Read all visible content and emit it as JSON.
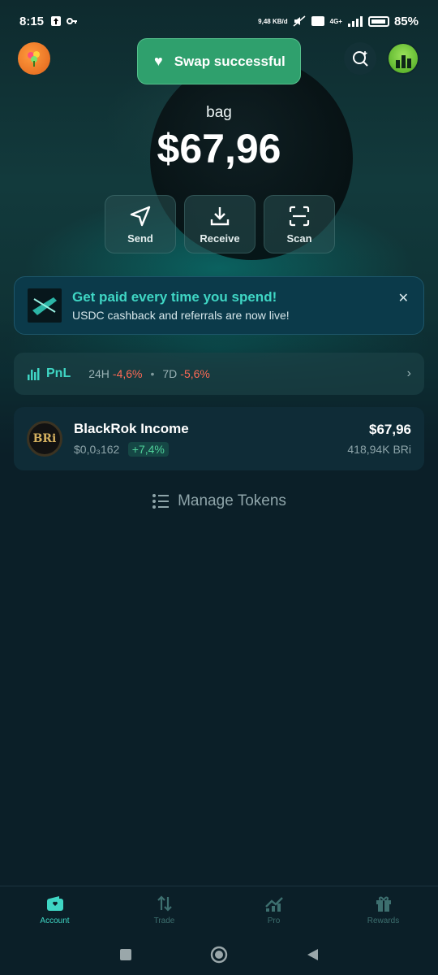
{
  "status_bar": {
    "time": "8:15",
    "network_speed": "9,48 KB/d",
    "network_type": "4G+",
    "battery_percent": "85%"
  },
  "header": {
    "toast_text": "Swap successful",
    "wallet_name": "bag",
    "balance": "$67,96"
  },
  "actions": [
    {
      "label": "Send",
      "icon": "send-icon"
    },
    {
      "label": "Receive",
      "icon": "download-icon"
    },
    {
      "label": "Scan",
      "icon": "scan-icon"
    }
  ],
  "promo": {
    "title": "Get paid every time you spend!",
    "subtitle": "USDC cashback and referrals are now live!"
  },
  "pnl": {
    "label": "PnL",
    "period_1": "24H",
    "value_1": "-4,6%",
    "period_2": "7D",
    "value_2": "-5,6%"
  },
  "token": {
    "logo_text": "BRi",
    "name": "BlackRok Income",
    "price": "$0,0₃162",
    "change": "+7,4%",
    "value": "$67,96",
    "amount": "418,94K BRi"
  },
  "manage_tokens": "Manage Tokens",
  "nav": [
    {
      "label": "Account",
      "icon": "wallet-icon",
      "active": true
    },
    {
      "label": "Trade",
      "icon": "swap-arrows-icon",
      "active": false
    },
    {
      "label": "Pro",
      "icon": "chart-icon",
      "active": false
    },
    {
      "label": "Rewards",
      "icon": "gift-icon",
      "active": false
    }
  ],
  "colors": {
    "accent": "#3fd6c4",
    "toast": "#2fa06d",
    "negative": "#ff6a55",
    "positive": "#4fd19a",
    "background": "#0b1f28"
  }
}
